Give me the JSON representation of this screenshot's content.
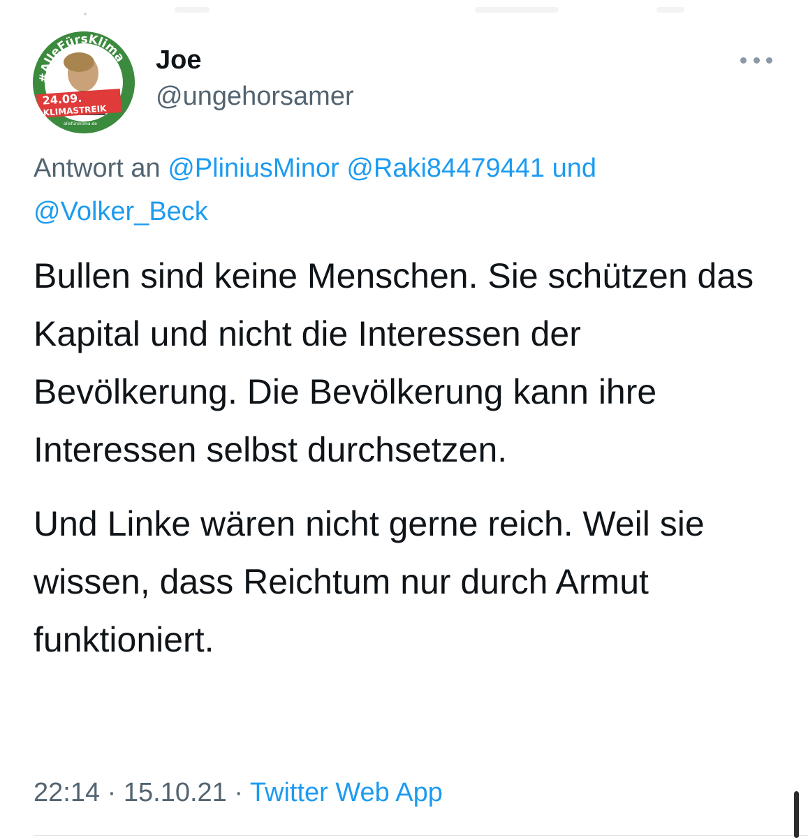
{
  "tweet": {
    "avatar": {
      "alt_text": [
        "#AlleFürsKlima",
        "24.09.",
        "KLIMASTREIK",
        "allefürsklima.de"
      ],
      "colors": {
        "ring": "#3b8a3e",
        "banner": "#e03a3a"
      }
    },
    "display_name": "Joe",
    "handle": "@ungehorsamer",
    "more_icon": "more-horizontal-icon",
    "reply_to": {
      "prefix": "Antwort an",
      "mention_1": "@PliniusMinor",
      "mention_2": "@Raki84479441",
      "conjunction": "und",
      "mention_3": "@Volker_Beck"
    },
    "text": {
      "paragraph_1": "Bullen sind keine Menschen. Sie schützen das Kapital und nicht die Interessen der Bevölkerung. Die Bevölkerung kann ihre Interessen selbst durchsetzen.",
      "paragraph_2": "Und Linke wären nicht gerne reich. Weil sie wissen, dass Reichtum nur durch Armut funktioniert."
    },
    "meta": {
      "time": "22:14",
      "separator": "·",
      "date": "15.10.21",
      "source": "Twitter Web App"
    }
  },
  "colors": {
    "text_primary": "#0f1419",
    "text_secondary": "#536471",
    "link": "#1d9bf0"
  }
}
